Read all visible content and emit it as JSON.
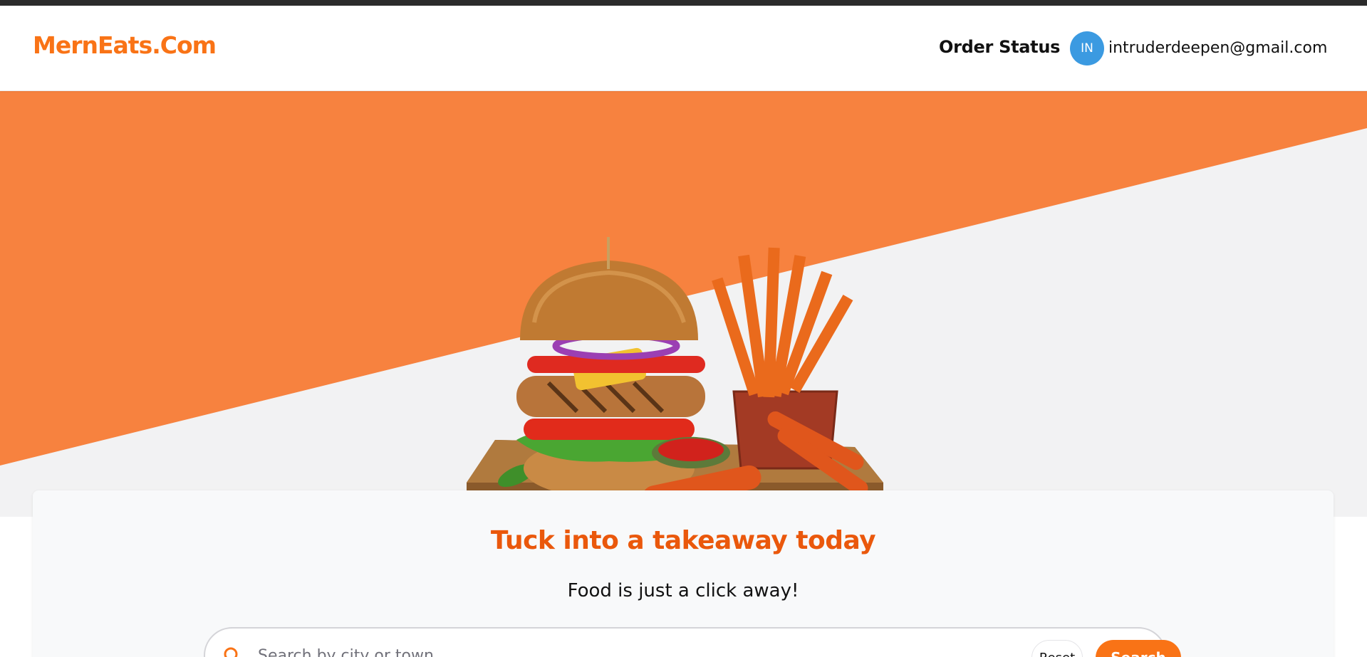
{
  "header": {
    "logo": "MernEats.Com",
    "order_status": "Order Status",
    "avatar_initials": "IN",
    "user_email": "intruderdeepen@gmail.com"
  },
  "hero": {
    "image": "burger-and-fries-food-image",
    "accent_color": "#f7823f",
    "background_color": "#f2f2f3"
  },
  "card": {
    "headline": "Tuck into a takeaway today",
    "tagline": "Food is just a click away!",
    "search": {
      "placeholder": "Search by city or town",
      "icon": "search-icon",
      "reset_label": "Reset",
      "search_label": "Search"
    }
  },
  "colors": {
    "brand": "#f97316",
    "headline": "#ea580c",
    "avatar": "#3b9ae1"
  }
}
